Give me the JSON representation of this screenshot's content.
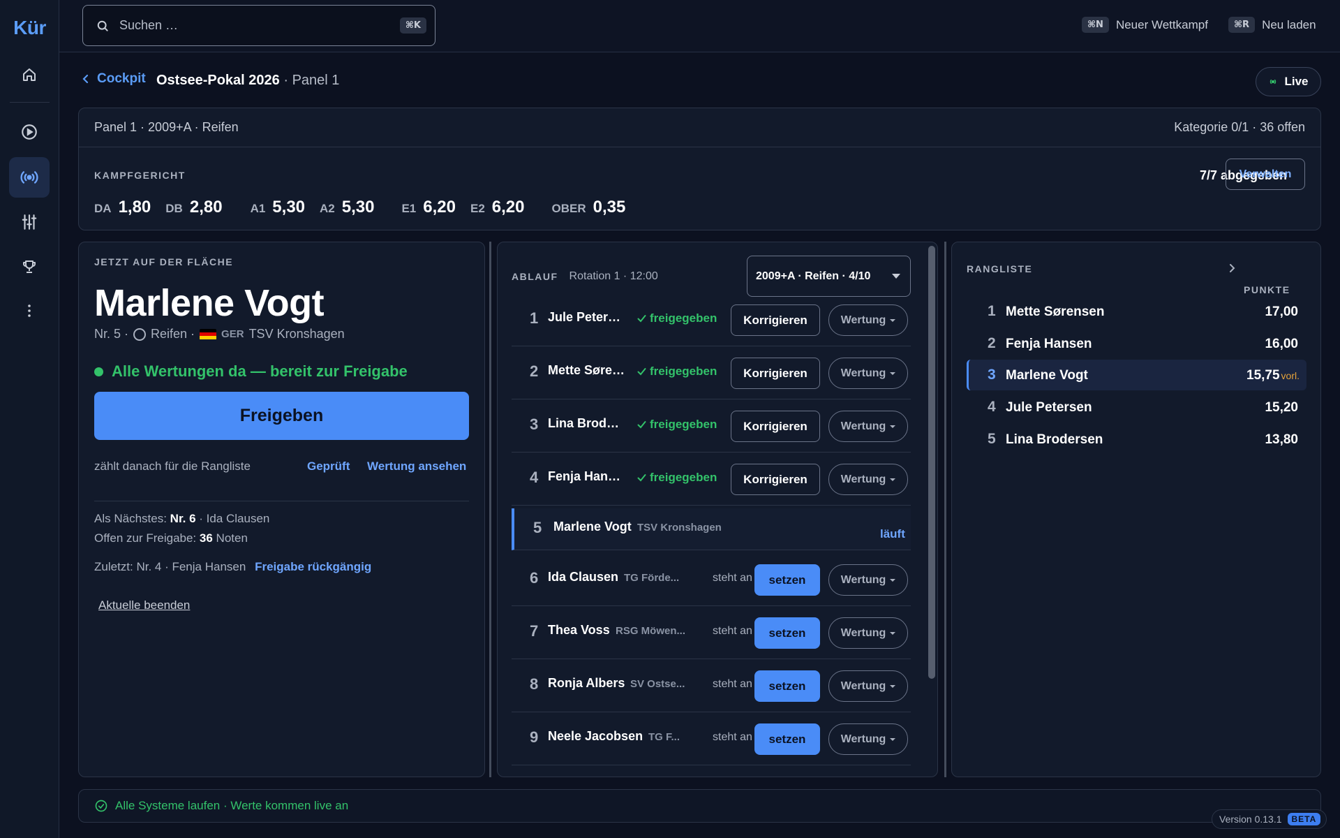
{
  "app": {
    "logo": "Kür"
  },
  "sidebar": {
    "items": [
      {
        "name": "home",
        "icon": "home-icon"
      },
      {
        "name": "play",
        "icon": "play-circle-icon"
      },
      {
        "name": "live",
        "icon": "broadcast-icon",
        "active": true
      },
      {
        "name": "settings",
        "icon": "sliders-icon"
      },
      {
        "name": "trophy",
        "icon": "trophy-icon"
      },
      {
        "name": "more",
        "icon": "more-vertical-icon"
      }
    ]
  },
  "search": {
    "placeholder": "Suchen …",
    "shortcut": "⌘K"
  },
  "topbar": {
    "new_competition": {
      "kbd": "⌘N",
      "label": "Neuer Wettkampf"
    },
    "reload": {
      "kbd": "⌘R",
      "label": "Neu laden"
    }
  },
  "header": {
    "back_label": "Cockpit",
    "title": "Ostsee-Pokal 2026",
    "title_sep": " · ",
    "subtitle": "Panel 1",
    "live_label": "Live"
  },
  "judge_panel": {
    "info": "Panel 1 · 2009+A · Reifen",
    "category": "Kategorie 0/1 · 36 offen",
    "overline": "KAMPFGERICHT",
    "submitted": "7/7 abgegeben",
    "manage_label": "Verwalten",
    "scores": [
      {
        "label": "DA",
        "value": "1,80"
      },
      {
        "label": "DB",
        "value": "2,80"
      },
      {
        "label": "A1",
        "value": "5,30"
      },
      {
        "label": "A2",
        "value": "5,30"
      },
      {
        "label": "E1",
        "value": "6,20"
      },
      {
        "label": "E2",
        "value": "6,20"
      },
      {
        "label": "OBER",
        "value": "0,35"
      }
    ]
  },
  "now": {
    "overline": "JETZT AUF DER FLÄCHE",
    "name": "Marlene Vogt",
    "number": "Nr. 5 ·",
    "apparatus": "Reifen ·",
    "nation": "GER",
    "club": "TSV Kronshagen",
    "flag_colors": [
      "#000000",
      "#dd0000",
      "#ffce00"
    ],
    "ready_text": "Alle Wertungen da — bereit zur Freigabe",
    "release_label": "Freigeben",
    "hint": "zählt danach für die Rangliste",
    "checked_label": "Geprüft",
    "view_label": "Wertung ansehen",
    "next_prefix": "Als Nächstes:",
    "next_nr": "Nr. 6",
    "next_name": "· Ida Clausen",
    "open_prefix": "Offen zur Freigabe:",
    "open_count": "36",
    "open_suffix": "Noten",
    "last_text": "Zuletzt: Nr. 4 · Fenja Hansen",
    "undo_label": "Freigabe rückgängig",
    "finish_label": "Aktuelle beenden"
  },
  "ablauf": {
    "overline": "ABLAUF",
    "rotation": "Rotation 1 · 12:00",
    "select_value": "2009+A · Reifen · 4/10",
    "correct_label": "Korrigieren",
    "set_label": "setzen",
    "score_label": "Wertung",
    "released_label": "freigegeben",
    "waiting_label": "steht an",
    "running_label": "läuft",
    "rows": [
      {
        "nr": "1",
        "name": "Jule Petersen",
        "club": "",
        "state": "released"
      },
      {
        "nr": "2",
        "name": "Mette Sørensen",
        "club": "",
        "state": "released"
      },
      {
        "nr": "3",
        "name": "Lina Brodersen",
        "club": "",
        "state": "released"
      },
      {
        "nr": "4",
        "name": "Fenja Hansen",
        "club": "",
        "state": "released"
      },
      {
        "nr": "5",
        "name": "Marlene Vogt",
        "club": "TSV Kronshagen",
        "state": "running"
      },
      {
        "nr": "6",
        "name": "Ida Clausen",
        "club": "TG Förde...",
        "state": "waiting"
      },
      {
        "nr": "7",
        "name": "Thea Voss",
        "club": "RSG Möwen...",
        "state": "waiting"
      },
      {
        "nr": "8",
        "name": "Ronja Albers",
        "club": "SV Ostse...",
        "state": "waiting"
      },
      {
        "nr": "9",
        "name": "Neele Jacobsen",
        "club": "TG F...",
        "state": "waiting"
      }
    ]
  },
  "ranking": {
    "overline": "RANGLISTE",
    "points_label": "PUNKTE",
    "provisional": "vorl.",
    "rows": [
      {
        "rank": "1",
        "name": "Mette Sørensen",
        "points": "17,00"
      },
      {
        "rank": "2",
        "name": "Fenja Hansen",
        "points": "16,00"
      },
      {
        "rank": "3",
        "name": "Marlene Vogt",
        "points": "15,75",
        "current": true
      },
      {
        "rank": "4",
        "name": "Jule Petersen",
        "points": "15,20"
      },
      {
        "rank": "5",
        "name": "Lina Brodersen",
        "points": "13,80"
      }
    ]
  },
  "status": {
    "text": "Alle Systeme laufen · Werte kommen live an"
  },
  "version": {
    "text": "Version 0.13.1",
    "badge": "BETA"
  }
}
